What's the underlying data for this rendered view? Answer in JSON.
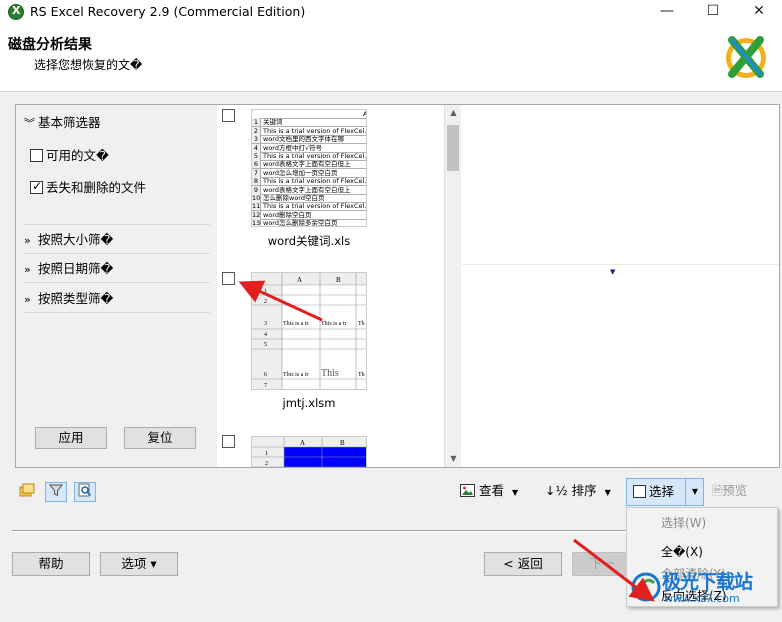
{
  "window": {
    "title": "RS Excel Recovery 2.9 (Commercial Edition)",
    "minimize": "—",
    "maximize": "☐",
    "close": "✕"
  },
  "header": {
    "title": "磁盘分析结果",
    "subtitle": "选择您想恢复的文�"
  },
  "filters": {
    "basic": {
      "label": "基本筛选器",
      "expanded": true
    },
    "available_files": {
      "label": "可用的文�",
      "checked": false
    },
    "lost_deleted": {
      "label": "丢失和删除的文件",
      "checked": true
    },
    "by_size": "按照大小筛�",
    "by_date": "按照日期筛�",
    "by_type": "按照类型筛�",
    "apply": "应用",
    "reset": "复位"
  },
  "files": [
    {
      "name": "word关键词.xls",
      "checked": false,
      "rows": [
        {
          "n": "",
          "text": "A"
        },
        {
          "n": "1",
          "text": "关键词"
        },
        {
          "n": "2",
          "text": "This is a trial version of FlexCel. plea"
        },
        {
          "n": "3",
          "text": "word文档里的西文字体在哪"
        },
        {
          "n": "4",
          "text": "word方框中打√符号"
        },
        {
          "n": "5",
          "text": "This is a trial version of FlexCel. plea"
        },
        {
          "n": "6",
          "text": "word表格文字上面有空白但上"
        },
        {
          "n": "7",
          "text": "word怎么增加一页空白页"
        },
        {
          "n": "8",
          "text": "This is a trial version of FlexCel. plea"
        },
        {
          "n": "9",
          "text": "word表格文字上面有空白但上"
        },
        {
          "n": "10",
          "text": "怎么删除word空白页"
        },
        {
          "n": "11",
          "text": "This is a trial version of FlexCel. plea"
        },
        {
          "n": "12",
          "text": "word删除空白页"
        },
        {
          "n": "13",
          "text": "word怎么删除多余空白页"
        }
      ]
    },
    {
      "name": "jmtj.xlsm",
      "checked": false,
      "cols": [
        "A",
        "B"
      ],
      "cells": [
        "This is a tr",
        "This is a tr",
        "Th",
        "This is a tr",
        "This",
        "Th"
      ],
      "row_numbers": [
        "1",
        "2",
        "3",
        "4",
        "5",
        "6",
        "7"
      ]
    },
    {
      "name": "",
      "checked": false,
      "cols": [
        "A",
        "B"
      ],
      "row_numbers": [
        "1",
        "2"
      ]
    }
  ],
  "toolbar": {
    "view": "查看",
    "sort": "排序",
    "select": "选择",
    "preview": "预览"
  },
  "select_menu": {
    "header": "选择(W)",
    "items": [
      "全�(X)",
      "全部清除(Y)",
      "反向选择(Z)"
    ]
  },
  "footer": {
    "help": "帮助",
    "options": "选项 ▾",
    "back": "< 返回",
    "next": "下一"
  },
  "watermark": {
    "text": "极光下载站",
    "url": "www.xz7.com"
  },
  "colors": {
    "accent_blue": "#1976d2",
    "arrow_red": "#e02020",
    "selected_cell": "#0000ff"
  }
}
